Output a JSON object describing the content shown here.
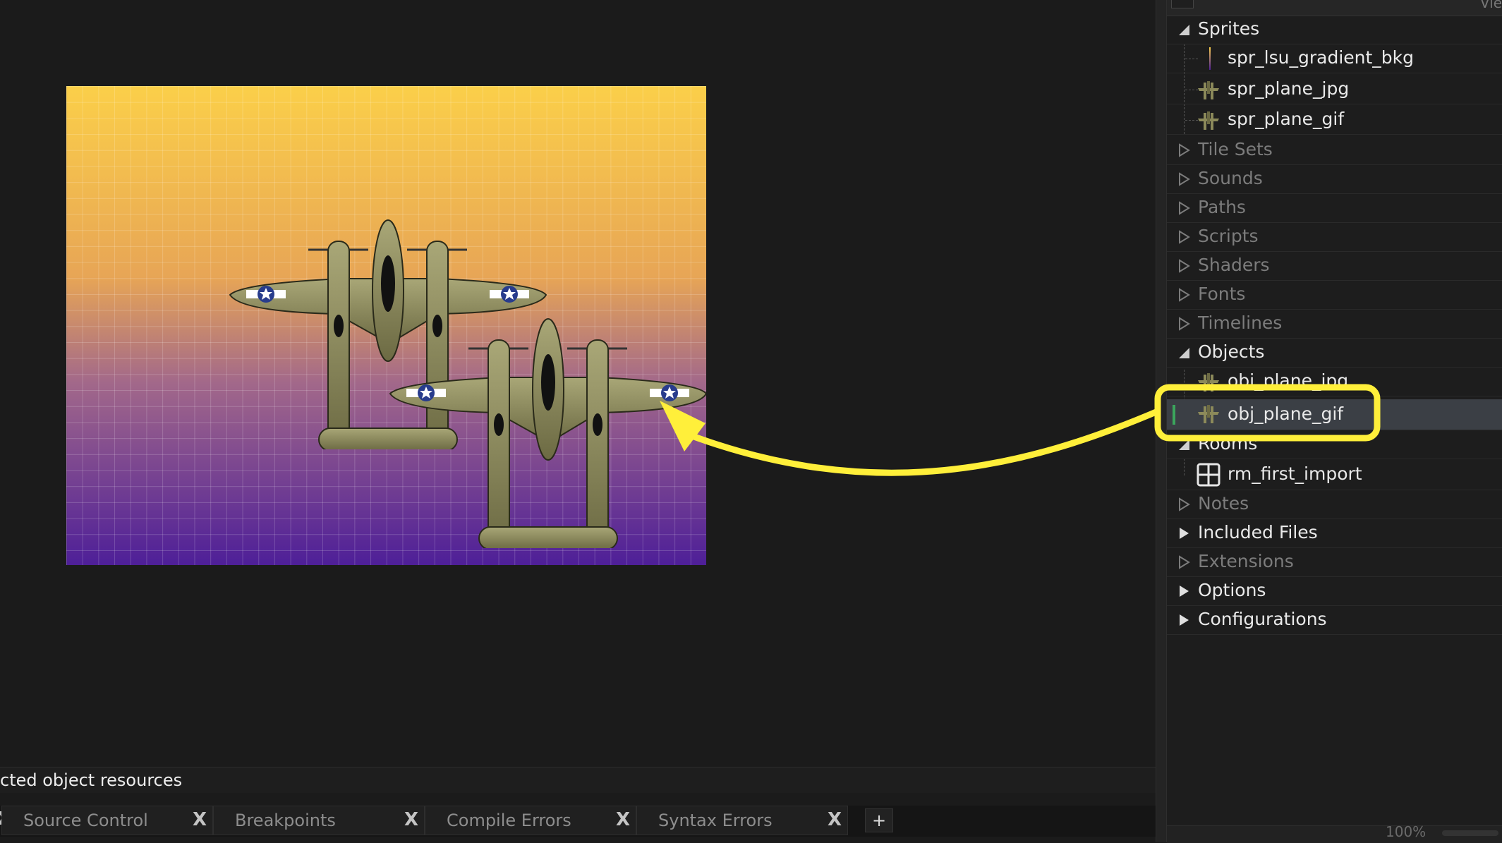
{
  "status": {
    "text": "cted object resources"
  },
  "bottom_tabs": [
    {
      "label": "Source Control"
    },
    {
      "label": "Breakpoints"
    },
    {
      "label": "Compile Errors"
    },
    {
      "label": "Syntax Errors"
    }
  ],
  "bottom_tabs_add": "+",
  "tab_close_glyph": "X",
  "tree_header_partial": "Vie",
  "tree": {
    "sprites": {
      "label": "Sprites",
      "children": [
        "spr_lsu_gradient_bkg",
        "spr_plane_jpg",
        "spr_plane_gif"
      ]
    },
    "tile_sets": "Tile Sets",
    "sounds": "Sounds",
    "paths": "Paths",
    "scripts": "Scripts",
    "shaders": "Shaders",
    "fonts": "Fonts",
    "timelines": "Timelines",
    "objects": {
      "label": "Objects",
      "children": [
        "obj_plane_jpg",
        "obj_plane_gif"
      ]
    },
    "rooms": {
      "label": "Rooms",
      "children": [
        "rm_first_import"
      ]
    },
    "notes": "Notes",
    "included_files": "Included Files",
    "extensions": "Extensions",
    "options": "Options",
    "configurations": "Configurations"
  },
  "zoom": "100%",
  "colors": {
    "highlight": "#ffef3a",
    "selected_row": "#3b3f45",
    "gradient_top": "#fbcf49",
    "gradient_bottom": "#4e1f98",
    "plane_body": "#8c8a5a"
  },
  "icons": [
    "sprite-plane-icon",
    "room-grid-icon",
    "expand-arrow-icon",
    "collapse-arrow-icon",
    "close-icon"
  ]
}
